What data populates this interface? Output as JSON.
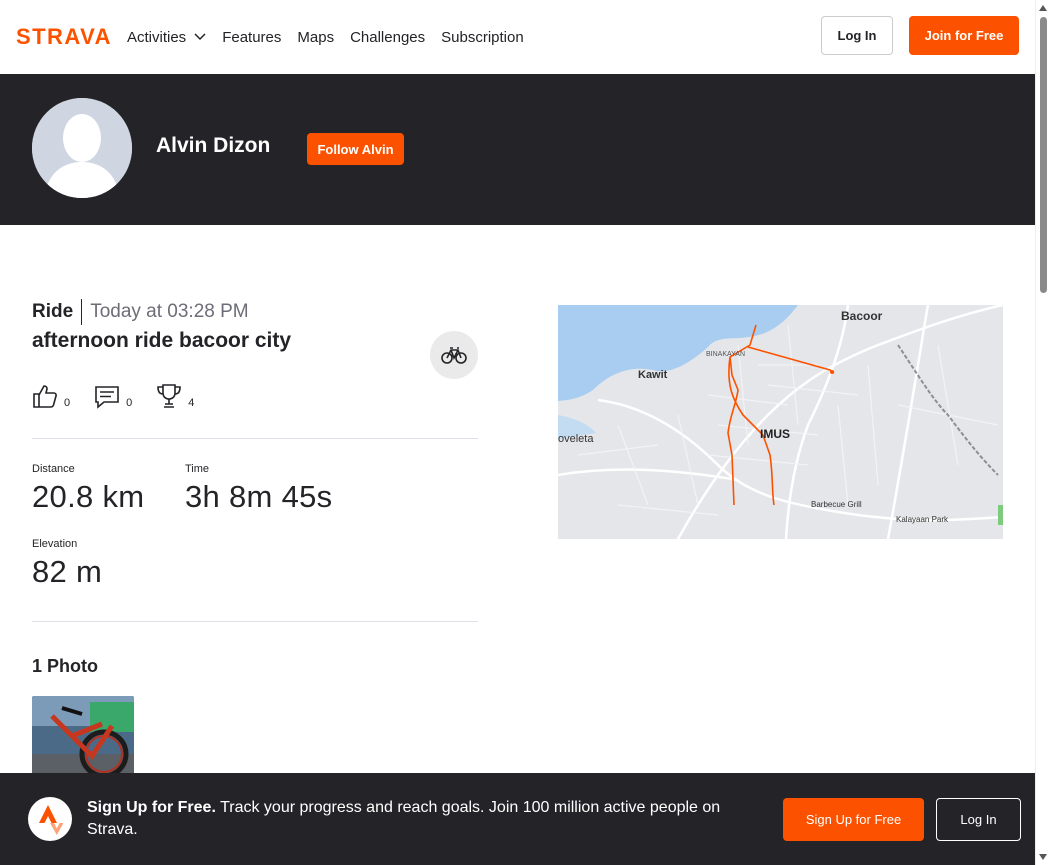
{
  "brand": {
    "logo_text": "STRAVA",
    "accent_color": "#fc5200",
    "dark_color": "#242428"
  },
  "nav": {
    "items": [
      {
        "label": "Activities",
        "has_dropdown": true
      },
      {
        "label": "Features"
      },
      {
        "label": "Maps"
      },
      {
        "label": "Challenges"
      },
      {
        "label": "Subscription"
      }
    ],
    "login_label": "Log In",
    "join_label": "Join for Free"
  },
  "athlete": {
    "name": "Alvin Dizon",
    "follow_label": "Follow Alvin"
  },
  "activity": {
    "sport": "Ride",
    "date": "Today at 03:28 PM",
    "title": "afternoon ride bacoor city",
    "kudos_count": "0",
    "comments_count": "0",
    "achievements_count": "4",
    "stats": {
      "distance_label": "Distance",
      "distance_value": "20.8 km",
      "time_label": "Time",
      "time_value": "3h 8m 45s",
      "elevation_label": "Elevation",
      "elevation_value": "82 m"
    },
    "photos_title": "1 Photo"
  },
  "map": {
    "labels": {
      "bacoor": "Bacoor",
      "binakayan": "BINAKAYAN",
      "kawit": "Kawit",
      "imus": "IMUS",
      "noveleta": "oveleta",
      "barbecue": "Barbecue Grill",
      "kalayaan": "Kalayaan Park"
    },
    "route_color": "#fc5200",
    "water_color": "#a8cdf0"
  },
  "banner": {
    "headline": "Sign Up for Free.",
    "body": "Track your progress and reach goals. Join 100 million active people on Strava.",
    "signup_label": "Sign Up for Free",
    "login_label": "Log In"
  }
}
